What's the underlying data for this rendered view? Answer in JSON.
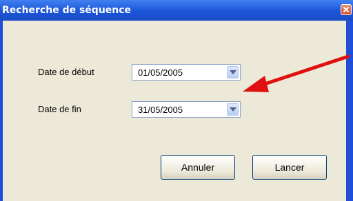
{
  "window": {
    "title": "Recherche de séquence"
  },
  "form": {
    "start_label": "Date de début",
    "start_value": "01/05/2005",
    "end_label": "Date de fin",
    "end_value": "31/05/2005"
  },
  "buttons": {
    "cancel": "Annuler",
    "launch": "Lancer"
  },
  "colors": {
    "annotation_arrow": "#e01010",
    "titlebar": "#1b55d8",
    "client_bg": "#ede9d8"
  },
  "icons": {
    "close": "close-icon",
    "dropdown": "chevron-down-icon"
  }
}
